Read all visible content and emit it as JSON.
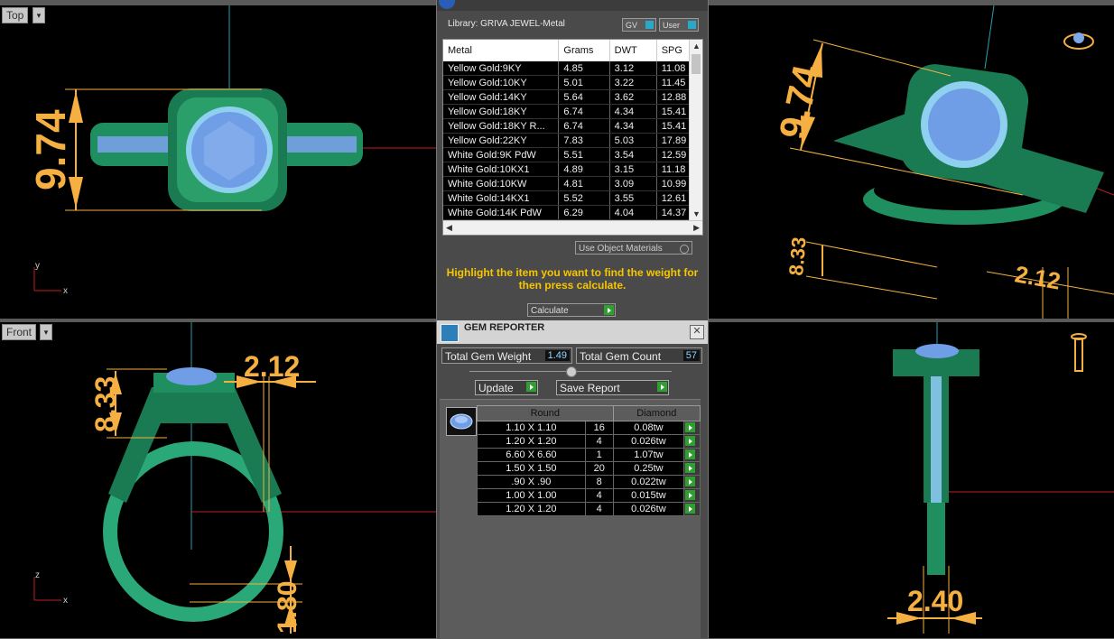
{
  "viewports": {
    "top": {
      "label": "Top",
      "dim_vertical": "9.74",
      "axis_y": "y",
      "axis_x": "x"
    },
    "perspective": {
      "dim_a": "9.74",
      "dim_b": "8.33",
      "dim_c": "2.12"
    },
    "front": {
      "label": "Front",
      "dim_height": "8.33",
      "dim_width": "2.12",
      "dim_shank": "1.80",
      "axis_z": "z",
      "axis_x": "x"
    },
    "right": {
      "dim_width": "2.40"
    }
  },
  "metal_panel": {
    "library_label": "Library: GRIVA JEWEL-Metal",
    "gv_button": "GV",
    "user_button": "User",
    "columns": [
      "Metal",
      "Grams",
      "DWT",
      "SPG"
    ],
    "rows": [
      [
        "Yellow Gold:9KY",
        "4.85",
        "3.12",
        "11.08"
      ],
      [
        "Yellow Gold:10KY",
        "5.01",
        "3.22",
        "11.45"
      ],
      [
        "Yellow Gold:14KY",
        "5.64",
        "3.62",
        "12.88"
      ],
      [
        "Yellow Gold:18KY",
        "6.74",
        "4.34",
        "15.41"
      ],
      [
        "Yellow Gold:18KY R...",
        "6.74",
        "4.34",
        "15.41"
      ],
      [
        "Yellow Gold:22KY",
        "7.83",
        "5.03",
        "17.89"
      ],
      [
        "White Gold:9K PdW",
        "5.51",
        "3.54",
        "12.59"
      ],
      [
        "White Gold:10KX1",
        "4.89",
        "3.15",
        "11.18"
      ],
      [
        "White Gold:10KW",
        "4.81",
        "3.09",
        "10.99"
      ],
      [
        "White Gold:14KX1",
        "5.52",
        "3.55",
        "12.61"
      ],
      [
        "White Gold:14K PdW",
        "6.29",
        "4.04",
        "14.37"
      ]
    ],
    "use_object_materials": "Use Object Materials",
    "hint": "Highlight the item you want to find the weight for then press calculate.",
    "calculate_button": "Calculate"
  },
  "gem_reporter": {
    "title": "GEM REPORTER",
    "close": "✕",
    "total_weight_label": "Total Gem Weight",
    "total_weight": "1.49",
    "total_count_label": "Total Gem Count",
    "total_count": "57",
    "update_button": "Update",
    "save_report_button": "Save Report",
    "header_shape": "Round",
    "header_type": "Diamond",
    "gems": [
      [
        "1.10 X 1.10",
        "16",
        "0.08tw"
      ],
      [
        "1.20 X 1.20",
        "4",
        "0.026tw"
      ],
      [
        "6.60 X 6.60",
        "1",
        "1.07tw"
      ],
      [
        "1.50 X 1.50",
        "20",
        "0.25tw"
      ],
      [
        ".90 X .90",
        "8",
        "0.022tw"
      ],
      [
        "1.00 X 1.00",
        "4",
        "0.015tw"
      ],
      [
        "1.20 X 1.20",
        "4",
        "0.026tw"
      ]
    ]
  },
  "colors": {
    "ring_green": "#1f8f5f",
    "dimension": "#f5b041",
    "gem_blue": "#7fa8e8",
    "hint": "#f7c600"
  }
}
